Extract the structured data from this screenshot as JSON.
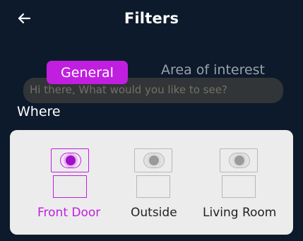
{
  "header": {
    "title": "Filters",
    "back_icon": "arrow-left-icon"
  },
  "tabs": [
    {
      "label": "General",
      "active": true
    },
    {
      "label": "Area of interest",
      "active": false
    }
  ],
  "ghost_prompt": "Hi there, What would you like to see?",
  "where": {
    "label": "Where",
    "locations": [
      {
        "label": "Front Door",
        "selected": true,
        "icon": "camera-icon"
      },
      {
        "label": "Outside",
        "selected": false,
        "icon": "camera-icon"
      },
      {
        "label": "Living Room",
        "selected": false,
        "icon": "camera-icon"
      }
    ]
  },
  "colors": {
    "accent": "#c11fe0",
    "background": "#0d1a2b",
    "panel": "#ececec",
    "inactive_text": "#222222"
  }
}
